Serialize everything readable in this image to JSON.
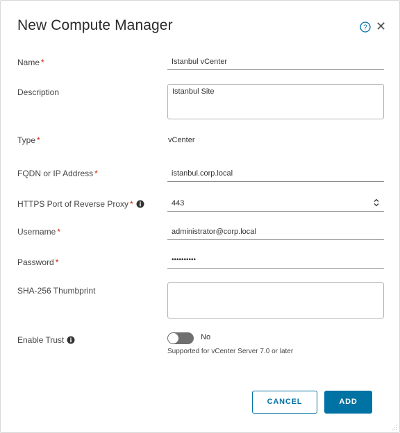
{
  "dialog": {
    "title": "New Compute Manager"
  },
  "form": {
    "required_mark": "*",
    "name": {
      "label": "Name",
      "value": "Istanbul vCenter"
    },
    "description": {
      "label": "Description",
      "value": "Istanbul Site"
    },
    "type": {
      "label": "Type",
      "value": "vCenter"
    },
    "fqdn": {
      "label": "FQDN or IP Address",
      "value": "istanbul.corp.local"
    },
    "port": {
      "label": "HTTPS Port of Reverse Proxy",
      "value": "443"
    },
    "username": {
      "label": "Username",
      "value": "administrator@corp.local"
    },
    "password": {
      "label": "Password",
      "value": "••••••••••"
    },
    "thumbprint": {
      "label": "SHA-256 Thumbprint",
      "value": ""
    },
    "enable_trust": {
      "label": "Enable Trust",
      "state": "No",
      "helper": "Supported for vCenter Server 7.0 or later"
    }
  },
  "buttons": {
    "cancel": "CANCEL",
    "add": "ADD"
  },
  "colors": {
    "accent": "#0072a3",
    "required": "#c92100",
    "toggle_off": "#6f6f6f"
  },
  "icons": [
    "help-icon",
    "close-icon",
    "info-icon",
    "spinner-icon",
    "resize-icon"
  ]
}
